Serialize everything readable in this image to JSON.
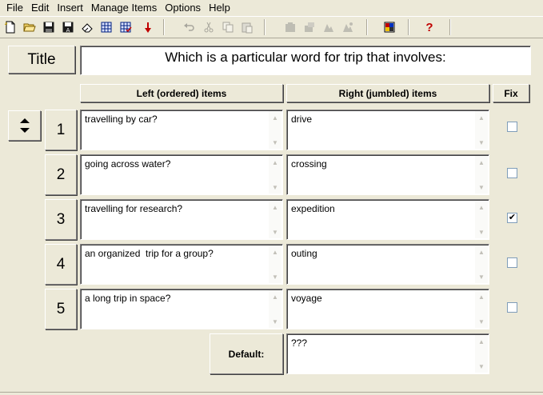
{
  "menu": [
    "File",
    "Edit",
    "Insert",
    "Manage Items",
    "Options",
    "Help"
  ],
  "toolbar": {
    "icons": [
      "new-file-icon",
      "open-folder-icon",
      "save-icon",
      "save-as-icon",
      "eraser-icon",
      "check-grid-icon",
      "check-grid-2-icon",
      "down-arrow-icon",
      "undo-icon",
      "cut-icon",
      "copy-icon",
      "paste-icon",
      "image-icon",
      "image-2-icon",
      "image-3-icon",
      "image-4-icon",
      "preview-icon",
      "help-icon"
    ],
    "help_glyph": "?"
  },
  "title": {
    "label": "Title",
    "value": "Which is a particular word for trip that involves:"
  },
  "headers": {
    "left": "Left (ordered) items",
    "right": "Right (jumbled) items",
    "fix": "Fix"
  },
  "rows": [
    {
      "num": "1",
      "left": "travelling by car?",
      "right": "drive",
      "fixed": false
    },
    {
      "num": "2",
      "left": "going across water?",
      "right": "crossing",
      "fixed": false
    },
    {
      "num": "3",
      "left": "travelling for research?",
      "right": "expedition",
      "fixed": true
    },
    {
      "num": "4",
      "left": "an organized  trip for a group?",
      "right": "outing",
      "fixed": false
    },
    {
      "num": "5",
      "left": "a long trip in space?",
      "right": "voyage",
      "fixed": false
    }
  ],
  "default": {
    "label": "Default:",
    "value": "???"
  },
  "colors": {
    "background": "#ece9d8",
    "checkbox_border": "#7f9db9"
  }
}
